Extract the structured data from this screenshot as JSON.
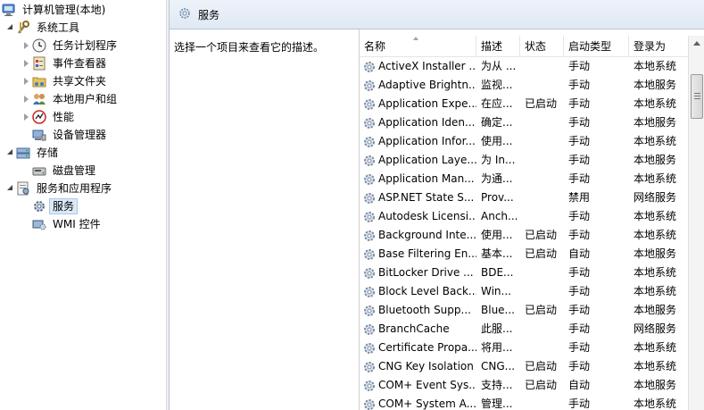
{
  "tree": {
    "root": "计算机管理(本地)",
    "items": [
      {
        "label": "系统工具",
        "icon": "tools-icon",
        "expander": "open"
      },
      {
        "label": "任务计划程序",
        "icon": "clock-icon",
        "expander": "closed"
      },
      {
        "label": "事件查看器",
        "icon": "event-viewer-icon",
        "expander": "closed"
      },
      {
        "label": "共享文件夹",
        "icon": "shared-folder-icon",
        "expander": "closed"
      },
      {
        "label": "本地用户和组",
        "icon": "users-icon",
        "expander": "closed"
      },
      {
        "label": "性能",
        "icon": "performance-icon",
        "expander": "closed"
      },
      {
        "label": "设备管理器",
        "icon": "device-manager-icon",
        "expander": "none"
      },
      {
        "label": "存储",
        "icon": "storage-icon",
        "expander": "open"
      },
      {
        "label": "磁盘管理",
        "icon": "disk-icon",
        "expander": "none"
      },
      {
        "label": "服务和应用程序",
        "icon": "services-apps-icon",
        "expander": "open"
      },
      {
        "label": "服务",
        "icon": "gear-icon",
        "expander": "none"
      },
      {
        "label": "WMI 控件",
        "icon": "wmi-icon",
        "expander": "none"
      }
    ]
  },
  "header": {
    "title": "服务"
  },
  "description": "选择一个项目来查看它的描述。",
  "columns": {
    "name": "名称",
    "desc": "描述",
    "status": "状态",
    "startup": "启动类型",
    "logon": "登录为"
  },
  "services": [
    {
      "name": "ActiveX Installer ...",
      "desc": "为从 ...",
      "status": "",
      "startup": "手动",
      "logon": "本地系统"
    },
    {
      "name": "Adaptive Brightn...",
      "desc": "监视...",
      "status": "",
      "startup": "手动",
      "logon": "本地服务"
    },
    {
      "name": "Application Expe...",
      "desc": "在应...",
      "status": "已启动",
      "startup": "手动",
      "logon": "本地系统"
    },
    {
      "name": "Application Iden...",
      "desc": "确定...",
      "status": "",
      "startup": "手动",
      "logon": "本地服务"
    },
    {
      "name": "Application Infor...",
      "desc": "使用...",
      "status": "",
      "startup": "手动",
      "logon": "本地系统"
    },
    {
      "name": "Application Laye...",
      "desc": "为 In...",
      "status": "",
      "startup": "手动",
      "logon": "本地服务"
    },
    {
      "name": "Application Man...",
      "desc": "为通...",
      "status": "",
      "startup": "手动",
      "logon": "本地系统"
    },
    {
      "name": "ASP.NET State S...",
      "desc": "Prov...",
      "status": "",
      "startup": "禁用",
      "logon": "网络服务"
    },
    {
      "name": "Autodesk Licensi...",
      "desc": "Anch...",
      "status": "",
      "startup": "手动",
      "logon": "本地系统"
    },
    {
      "name": "Background Inte...",
      "desc": "使用...",
      "status": "已启动",
      "startup": "手动",
      "logon": "本地系统"
    },
    {
      "name": "Base Filtering En...",
      "desc": "基本...",
      "status": "已启动",
      "startup": "自动",
      "logon": "本地服务"
    },
    {
      "name": "BitLocker Drive ...",
      "desc": "BDE...",
      "status": "",
      "startup": "手动",
      "logon": "本地系统"
    },
    {
      "name": "Block Level Back...",
      "desc": "Win...",
      "status": "",
      "startup": "手动",
      "logon": "本地系统"
    },
    {
      "name": "Bluetooth Supp...",
      "desc": "Blue...",
      "status": "已启动",
      "startup": "手动",
      "logon": "本地服务"
    },
    {
      "name": "BranchCache",
      "desc": "此服...",
      "status": "",
      "startup": "手动",
      "logon": "网络服务"
    },
    {
      "name": "Certificate Propa...",
      "desc": "将用...",
      "status": "",
      "startup": "手动",
      "logon": "本地系统"
    },
    {
      "name": "CNG Key Isolation",
      "desc": "CNG...",
      "status": "已启动",
      "startup": "手动",
      "logon": "本地系统"
    },
    {
      "name": "COM+ Event Sys...",
      "desc": "支持...",
      "status": "已启动",
      "startup": "自动",
      "logon": "本地服务"
    },
    {
      "name": "COM+ System A...",
      "desc": "管理...",
      "status": "",
      "startup": "手动",
      "logon": "本地系统"
    }
  ]
}
